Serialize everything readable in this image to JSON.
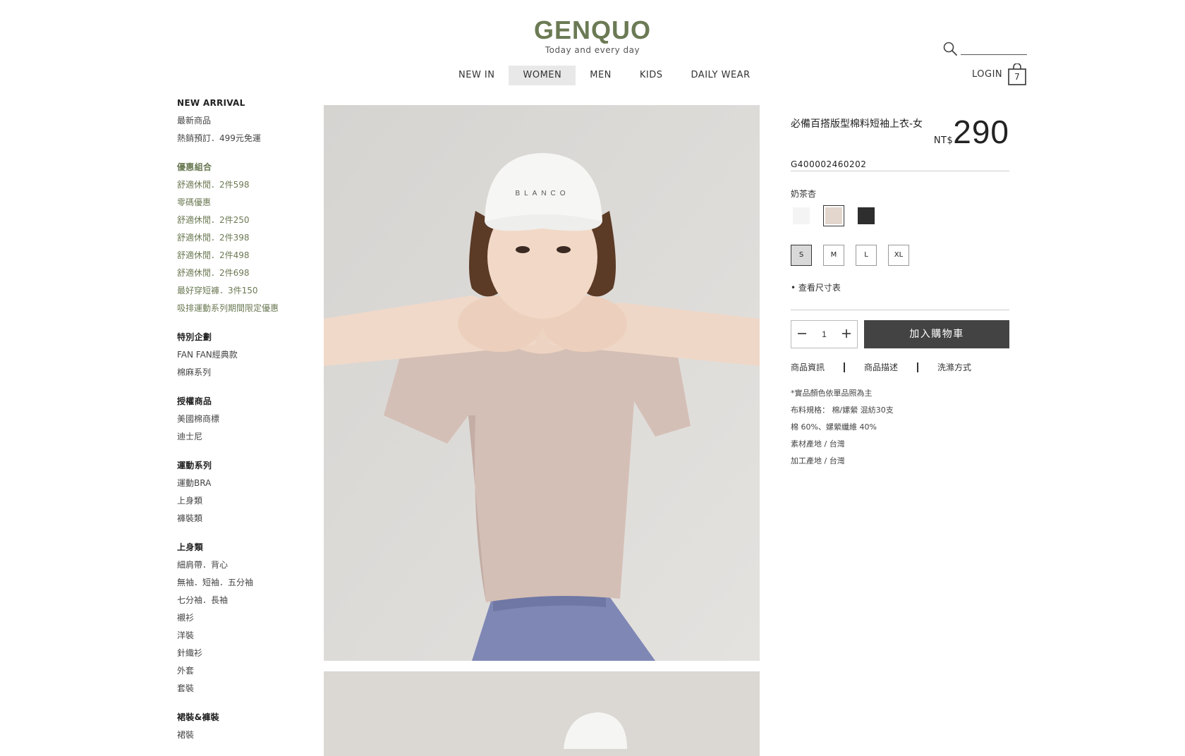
{
  "header": {
    "brand": "GENQUO",
    "tagline": "Today and every day",
    "nav": [
      {
        "label": "NEW IN",
        "active": false
      },
      {
        "label": "WOMEN",
        "active": true
      },
      {
        "label": "MEN",
        "active": false
      },
      {
        "label": "KIDS",
        "active": false
      },
      {
        "label": "DAILY WEAR",
        "active": false
      }
    ],
    "search_placeholder": "",
    "search_icon": "search-icon",
    "login_label": "LOGIN",
    "cart_icon": "shopping-bag-icon",
    "cart_count": "7",
    "brand_color": "#6b7a54"
  },
  "sidebar": {
    "groups": [
      {
        "heading": "NEW ARRIVAL",
        "promo": false,
        "items": [
          "最新商品",
          "熱銷預訂．499元免運"
        ]
      },
      {
        "heading": "優惠組合",
        "promo": true,
        "items": [
          "舒適休閒．2件598",
          "零碼優惠",
          "舒適休閒．2件250",
          "舒適休閒．2件398",
          "舒適休閒．2件498",
          "舒適休閒．2件698",
          "最好穿短褲．3件150",
          "吸排運動系列期間限定優惠"
        ]
      },
      {
        "heading": "特別企劃",
        "promo": false,
        "items": [
          "FAN FAN經典款",
          "棉麻系列"
        ]
      },
      {
        "heading": "授權商品",
        "promo": false,
        "items": [
          "美國棉商標",
          "迪士尼"
        ]
      },
      {
        "heading": "運動系列",
        "promo": false,
        "items": [
          "運動BRA",
          "上身類",
          "褲裝類"
        ]
      },
      {
        "heading": "上身類",
        "promo": false,
        "items": [
          "細肩帶．背心",
          "無袖．短袖．五分袖",
          "七分袖．長袖",
          "襯衫",
          "洋裝",
          "針織衫",
          "外套",
          "套裝"
        ]
      },
      {
        "heading": "裙裝&褲裝",
        "promo": false,
        "items": [
          "裙裝"
        ]
      }
    ]
  },
  "product": {
    "name": "必備百搭版型棉料短袖上衣-女",
    "currency": "NT$",
    "price": "290",
    "sku": "G400002460202",
    "color_label": "奶茶杏",
    "colors": [
      {
        "name": "white",
        "hex": "#f4f4f4",
        "selected": false
      },
      {
        "name": "奶茶杏",
        "hex": "#e3d6cd",
        "selected": true
      },
      {
        "name": "black",
        "hex": "#2e2e2e",
        "selected": false
      }
    ],
    "sizes": [
      {
        "label": "S",
        "selected": true
      },
      {
        "label": "M",
        "selected": false
      },
      {
        "label": "L",
        "selected": false
      },
      {
        "label": "XL",
        "selected": false
      }
    ],
    "size_chart_label": "• 查看尺寸表",
    "quantity": "1",
    "minus_icon": "minus-icon",
    "plus_icon": "plus-icon",
    "add_to_cart_label": "加入購物車",
    "tabs": [
      "商品資訊",
      "商品描述",
      "洗滌方式"
    ],
    "details": [
      "*實品顏色依單品照為主",
      "布料規格： 棉/嫘縈 混紡30支",
      "棉 60%、嫘縈纖維 40%",
      "素材產地 / 台灣",
      "加工產地 / 台灣"
    ]
  }
}
